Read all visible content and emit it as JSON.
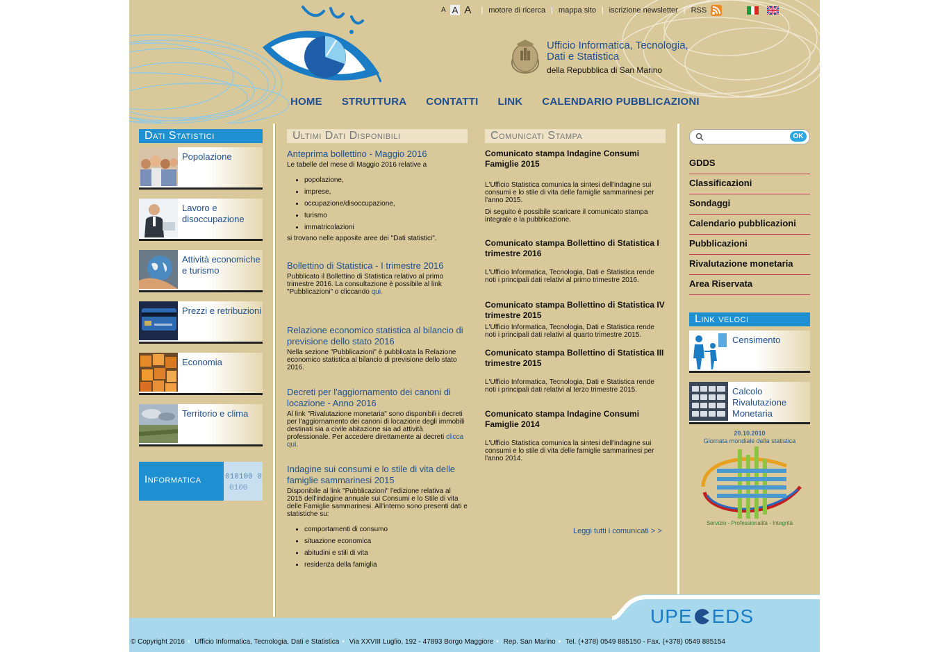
{
  "toplinks": {
    "font_small": "A",
    "font_medium": "A",
    "font_large": "A",
    "search_engine": "motore di ricerca",
    "sitemap": "mappa sito",
    "newsletter": "iscrizione newsletter",
    "rss": "RSS"
  },
  "org": {
    "line1": "Ufficio Informatica, Tecnologia,",
    "line2": "Dati e Statistica",
    "line3": "della Repubblica di San Marino"
  },
  "nav": [
    "HOME",
    "STRUTTURA",
    "CONTATTI",
    "LINK",
    "CALENDARIO PUBBLICAZIONI"
  ],
  "left": {
    "title": "Dati Statistici",
    "categories": [
      "Popolazione",
      "Lavoro e disoccupazione",
      "Attività economiche e turismo",
      "Prezzi e retribuzioni",
      "Economia",
      "Territorio e clima"
    ],
    "informatica": "Informatica",
    "informatica_bin": "010100 01100"
  },
  "mid": {
    "title": "Ultimi Dati Disponibili",
    "news": [
      {
        "title": "Anteprima bollettino - Maggio 2016",
        "text": "Le tabelle del mese di Maggio 2016 relative a",
        "items": [
          "popolazione,",
          "imprese,",
          "occupazione/disoccupazione,",
          "turismo",
          "immatricolazioni"
        ],
        "after": "si trovano nelle apposite aree dei \"Dati statistici\"."
      },
      {
        "title": "Bollettino di Statistica - I trimestre 2016",
        "text": "Pubblicato il Bollettino di Statistica relativo al primo trimestre 2016. La consultazione è possibile al link \"Pubblicazioni\" o cliccando",
        "link": "qui."
      },
      {
        "title": "Relazione economico statistica al bilancio di previsione dello stato 2016",
        "text": "Nella sezione \"Pubblicazioni\" è pubblicata la Relazione economico statistica al bilancio di previsione dello stato 2016."
      },
      {
        "title": "Decreti per l'aggiornamento dei canoni di locazione - Anno 2016",
        "text": "Al link \"Rivalutazione monetaria\" sono disponibili i decreti per l'aggiornamento dei canoni di locazione degli immobili destinati sia a civile abitazione sia ad attività professionale. Per accedere direttamente ai decreti",
        "link": "clicca qui."
      },
      {
        "title": "Indagine sui consumi e lo stile di vita delle famiglie sammarinesi 2015",
        "text": "Disponibile al link \"Pubblicazioni\" l'edizione relativa al 2015 dell'indagine annuale sui Consumi e lo Stile di vita delle Famiglie sammarinesi. All'interno sono presenti dati e statistiche su:",
        "items": [
          "comportamenti di consumo",
          "situazione economica",
          "abitudini e stili di vita",
          "residenza della famiglia"
        ]
      }
    ]
  },
  "press": {
    "title": "Comunicati Stampa",
    "items": [
      {
        "title": "Comunicato stampa Indagine Consumi Famiglie 2015",
        "p1": "L'Ufficio Statistica comunica la sintesi dell'indagine sui consumi e lo stile di vita delle famiglie sammarinesi per l'anno 2015.",
        "p2": "Di seguito è possibile scaricare il comunicato stampa integrale e la pubblicazione."
      },
      {
        "title": "Comunicato stampa Bollettino di Statistica I trimestre 2016",
        "p1": "L'Ufficio Informatica, Tecnologia, Dati e Statistica rende noti i principali dati relativi al primo trimestre 2016."
      },
      {
        "title": "Comunicato stampa Bollettino di Statistica IV trimestre 2015",
        "p1": "L'Ufficio Informatica, Tecnologia, Dati e Statistica rende noti i principali dati relativi al quarto trimestre 2015."
      },
      {
        "title": "Comunicato stampa Bollettino di Statistica III trimestre 2015",
        "p1": "L'Ufficio Informatica, Tecnologia, Dati e Statistica rende noti i principali dati relativi al terzo trimestre 2015."
      },
      {
        "title": "Comunicato stampa Indagine Consumi Famiglie 2014",
        "p1": "L'Ufficio Statistica comunica la sintesi dell'indagine sui consumi e lo stile di vita delle famiglie sammarinesi per l'anno 2014."
      }
    ],
    "read_all": "Leggi tutti i comunicati > >"
  },
  "right": {
    "search_placeholder": "",
    "ok": "OK",
    "menu": [
      "GDDS",
      "Classificazioni",
      "Sondaggi",
      "Calendario pubblicazioni",
      "Pubblicazioni",
      "Rivalutazione monetaria",
      "Area Riservata"
    ],
    "quick_title": "Link veloci",
    "quick": [
      "Censimento",
      "Calcolo Rivalutazione Monetaria"
    ],
    "wsd_date": "20.10.2010",
    "wsd_title": "Giornata mondiale della statistica",
    "wsd_motto": "Servizio - Professionalità - Integrità"
  },
  "footer": {
    "brand_a": "UPE",
    "brand_b": "EDS",
    "copyright": [
      "© Copyright 2016",
      "Ufficio Informatica, Tecnologia, Dati e Statistica",
      "Via XXVIII Luglio, 192 - 47893 Borgo Maggiore",
      "Rep. San Marino",
      "Tel. (+378) 0549 885150 - Fax. (+378) 0549 885154"
    ]
  },
  "colors": {
    "background": "#d9c99a",
    "accent": "#1e8fd0",
    "link": "#1f4f8f",
    "divider": "#c23a5a",
    "footer": "#a8d8ec"
  }
}
